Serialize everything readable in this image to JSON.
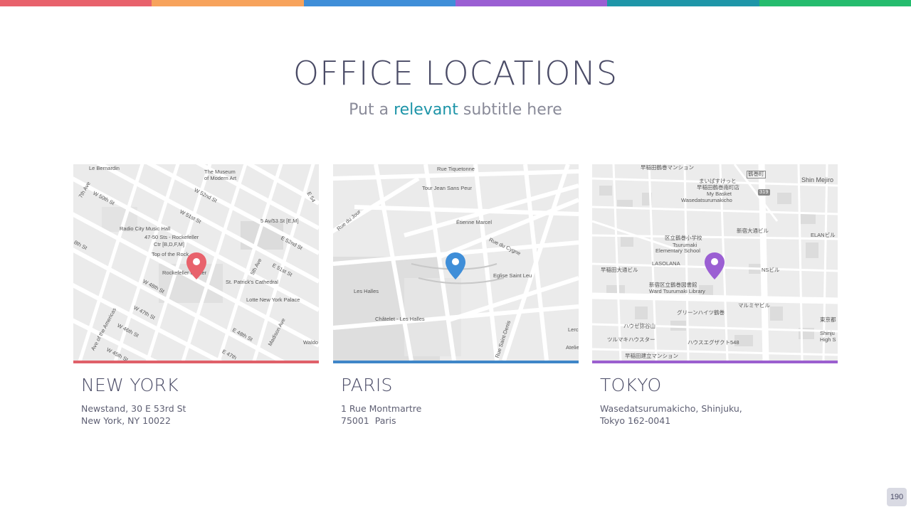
{
  "top_bar_colors": [
    "#e8626c",
    "#f7a35c",
    "#3f8ed8",
    "#9b5fd3",
    "#1e96a8",
    "#25bc6e"
  ],
  "title": "OFFICE LOCATIONS",
  "subtitle": {
    "before": "Put a ",
    "accent": "relevant",
    "after": " subtitle here",
    "accent_color": "#1d94a8"
  },
  "offices": [
    {
      "city": "NEW YORK",
      "address_line1": "Newstand, 30 E 53rd St",
      "address_line2": "New York, NY 10022",
      "accent_color": "#e06069",
      "pin_icon": "location-pin-icon",
      "map_labels": [
        "Le Bernardin",
        "The Museum",
        "of Modern Art",
        "W 52nd St",
        "E 54",
        "7th Ave",
        "W 50th St",
        "W 51st St",
        "5 Av/53 St [E,M]",
        "Radio City Music Hall",
        "47-50 Sts - Rockefeller",
        "Ctr [B,D,F,M]",
        "E 52nd St",
        "8th St",
        "Top of the Rock",
        "Rockefeller Center",
        "5th Ave",
        "E 51st St",
        "W 48th St",
        "St. Patrick's Cathedral",
        "Lotte New York Palace",
        "W 47th St",
        "Ave of the Americas",
        "W 46th St",
        "W 45th St",
        "E 48th St",
        "Madison Ave",
        "E 47th",
        "Waldo"
      ]
    },
    {
      "city": "PARIS",
      "address_line1": "1 Rue Montmartre",
      "address_line2": "75001  Paris",
      "accent_color": "#3f86c8",
      "pin_icon": "location-pin-icon",
      "map_labels": [
        "Rue Tiquetonne",
        "Tour Jean Sans Peur",
        "Rue du Jour",
        "Étienne Marcel",
        "Rue du Cygne",
        "Eglise Saint Leu",
        "Les Halles",
        "Châtelet - Les Halles",
        "Rue Saint-Denis",
        "Lerc",
        "Atelie"
      ]
    },
    {
      "city": "TOKYO",
      "address_line1": "Wasedatsurumakicho, Shinjuku,",
      "address_line2": "Tokyo 162-0041",
      "accent_color": "#9b5fcf",
      "pin_icon": "location-pin-icon",
      "map_labels": [
        "早稲田鶴巻マンション",
        "鶴巻町",
        "まいばすけっと",
        "早稲田鶴巻南町店",
        "My Basket",
        "Wasedatsurumakicho",
        "Shin Mejiro",
        "319",
        "区立鶴巻小学校",
        "Tsurumaki",
        "Elementary School",
        "LASOLANA",
        "新宿大通ビル",
        "ELANビル",
        "NSビル",
        "早稲田大通ビル",
        "新宿区立鶴巻図書館",
        "Ward Tsurumaki Library",
        "グリーンハイツ鶴巻",
        "マルミヤビル",
        "ハウゼ弥谷山",
        "ツルマキハウスター",
        "ハウスエグザクト548",
        "東京都",
        "Shinju",
        "High S",
        "早稲田建立マンション"
      ]
    }
  ],
  "page_number": "190"
}
